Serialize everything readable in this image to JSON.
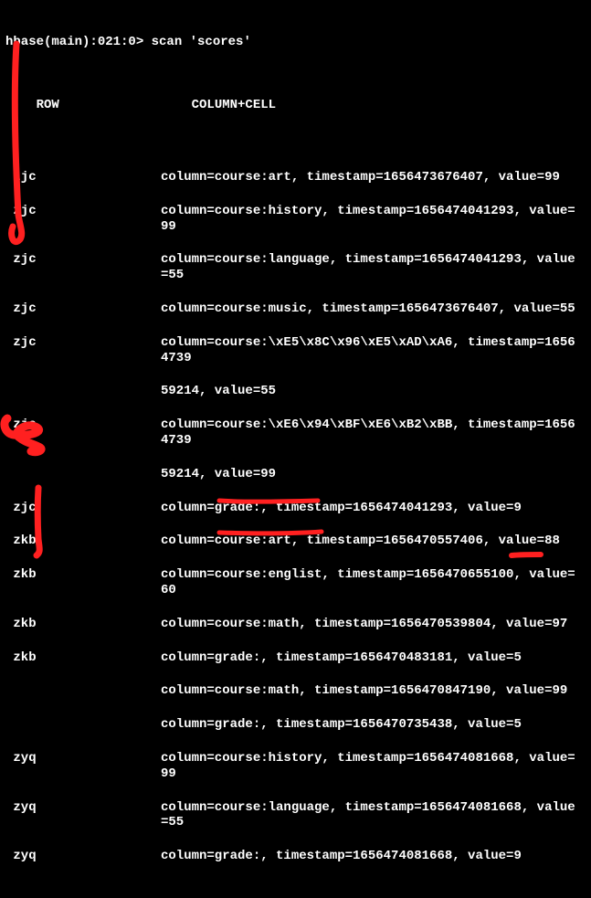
{
  "prompt": "hbase(main):021:0> scan 'scores'",
  "header": {
    "row": "ROW",
    "col": "COLUMN+CELL"
  },
  "rows": [
    {
      "row": "zjc",
      "cell": "column=course:art, timestamp=1656473676407, value=99"
    },
    {
      "row": "zjc",
      "cell": "column=course:history, timestamp=1656474041293, value=99"
    },
    {
      "row": "zjc",
      "cell": "column=course:language, timestamp=1656474041293, value=55"
    },
    {
      "row": "zjc",
      "cell": "column=course:music, timestamp=1656473676407, value=55"
    },
    {
      "row": "zjc",
      "cell": "column=course:\\xE5\\x8C\\x96\\xE5\\xAD\\xA6, timestamp=16564739",
      "cont": "59214, value=55"
    },
    {
      "row": "zjc",
      "cell": "column=course:\\xE6\\x94\\xBF\\xE6\\xB2\\xBB, timestamp=16564739",
      "cont": "59214, value=99"
    },
    {
      "row": "zjc",
      "cell": "column=grade:, timestamp=1656474041293, value=9"
    },
    {
      "row": "zkb",
      "cell": "column=course:art, timestamp=1656470557406, value=88"
    },
    {
      "row": "zkb",
      "cell": "column=course:englist, timestamp=1656470655100, value=60"
    },
    {
      "row": "zkb",
      "cell": "column=course:math, timestamp=1656470539804, value=97"
    },
    {
      "row": "zkb",
      "cell": "column=grade:, timestamp=1656470483181, value=5"
    },
    {
      "row": "",
      "cell": "column=course:math, timestamp=1656470847190, value=99"
    },
    {
      "row": "",
      "cell": "column=grade:, timestamp=1656470735438, value=5"
    },
    {
      "row": "zyq",
      "cell": "column=course:history, timestamp=1656474081668, value=99"
    },
    {
      "row": "zyq",
      "cell": "column=course:language, timestamp=1656474081668, value=55"
    },
    {
      "row": "zyq",
      "cell": "column=grade:, timestamp=1656474081668, value=9"
    }
  ]
}
